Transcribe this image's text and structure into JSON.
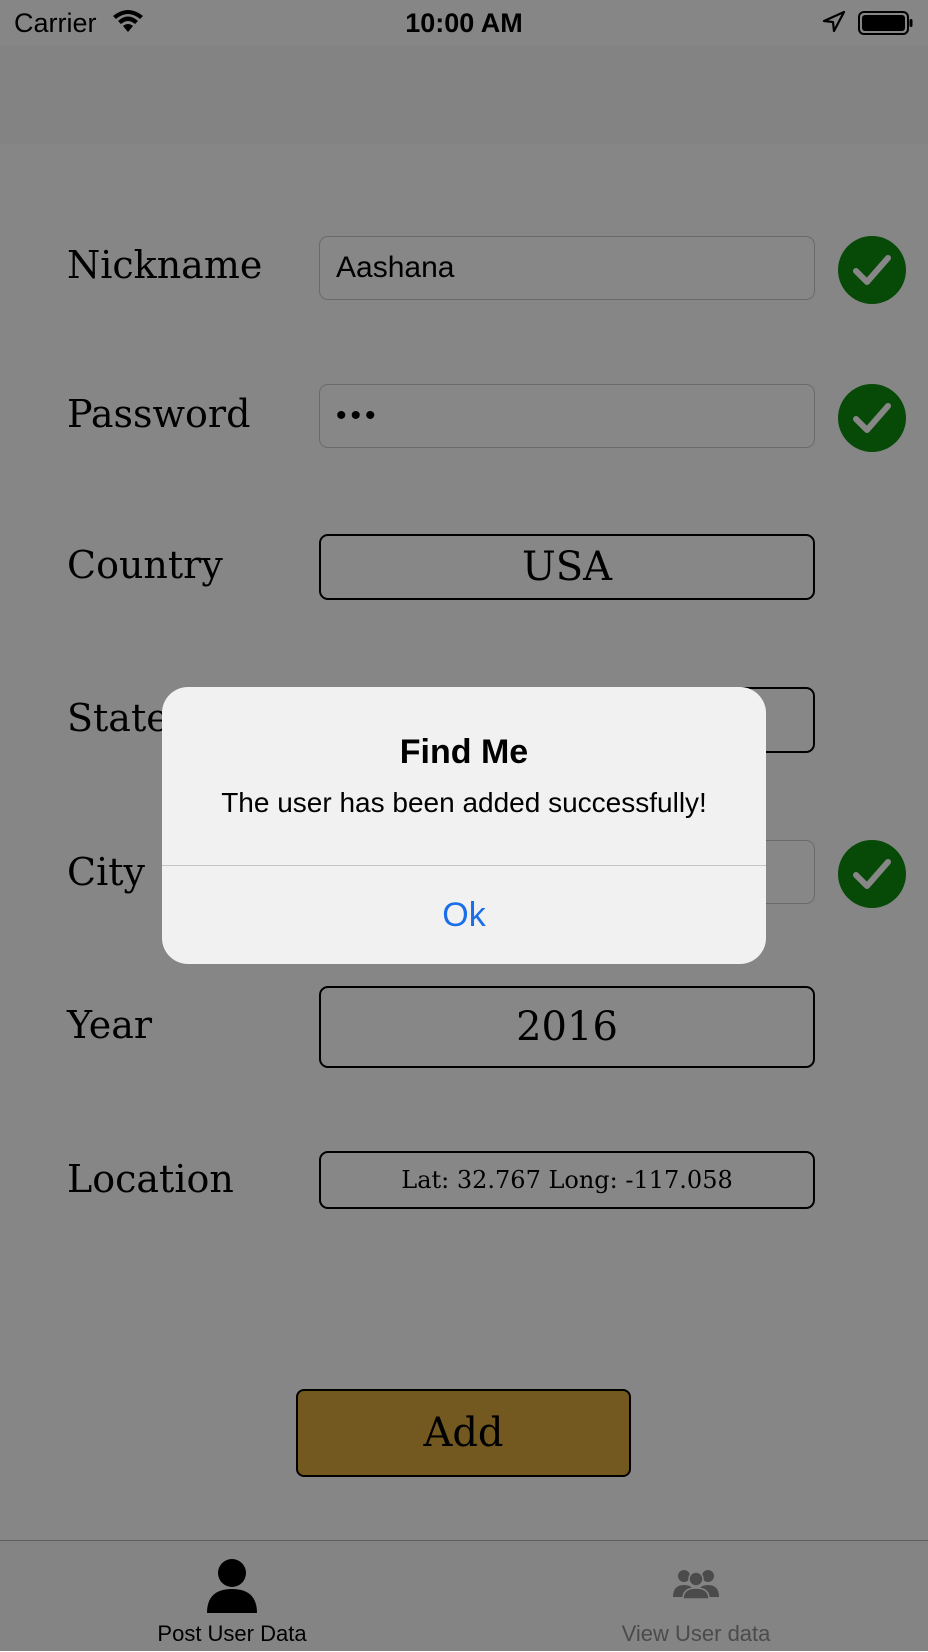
{
  "status_bar": {
    "carrier": "Carrier",
    "time": "10:00 AM",
    "wifi_icon": "wifi-icon",
    "location_icon": "location-arrow-icon",
    "battery_icon": "battery-full-icon"
  },
  "form": {
    "nickname": {
      "label": "Nickname",
      "value": "Aashana",
      "valid": true
    },
    "password": {
      "label": "Password",
      "value": "•••",
      "valid": true
    },
    "country": {
      "label": "Country",
      "value": "USA"
    },
    "state": {
      "label": "State"
    },
    "city": {
      "label": "City",
      "valid": true
    },
    "year": {
      "label": "Year",
      "value": "2016"
    },
    "location": {
      "label": "Location",
      "value": "Lat: 32.767 Long: -117.058"
    }
  },
  "add_button": {
    "label": "Add",
    "color": "#d9a83b"
  },
  "tab_bar": {
    "items": [
      {
        "label": "Post User Data",
        "icon": "user-icon",
        "selected": true
      },
      {
        "label": "View User data",
        "icon": "users-group-icon",
        "selected": false
      }
    ]
  },
  "alert": {
    "title": "Find Me",
    "message": "The user has been added successfully!",
    "ok_label": "Ok",
    "ok_color": "#1a6fe8"
  },
  "colors": {
    "check_green": "#0e8a0e",
    "overlay": "rgba(0,0,0,0.47)"
  }
}
